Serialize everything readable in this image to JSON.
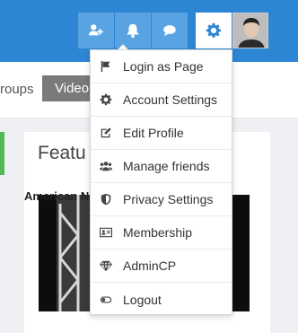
{
  "colors": {
    "accent": "#2d86d4",
    "button": "#5aa3e2",
    "success": "#52b957"
  },
  "topbar": {
    "buttons": [
      {
        "icon": "add-friend-icon"
      },
      {
        "icon": "bell-icon"
      },
      {
        "icon": "chat-icon"
      },
      {
        "icon": "gear-icon"
      }
    ]
  },
  "subnav": {
    "tab_groups_label": "roups",
    "tab_video_label": "Video"
  },
  "main": {
    "featured_title": "Featu",
    "video_title": "American Ninja Warrior 2017 ..."
  },
  "dropdown": {
    "items": [
      {
        "label": "Login as Page",
        "icon": "flag-icon"
      },
      {
        "label": "Account Settings",
        "icon": "cog-icon"
      },
      {
        "label": "Edit Profile",
        "icon": "edit-icon"
      },
      {
        "label": "Manage friends",
        "icon": "users-icon"
      },
      {
        "label": "Privacy Settings",
        "icon": "shield-icon"
      },
      {
        "label": "Membership",
        "icon": "id-card-icon"
      },
      {
        "label": "AdminCP",
        "icon": "diamond-icon"
      },
      {
        "label": "Logout",
        "icon": "toggle-icon"
      }
    ]
  }
}
